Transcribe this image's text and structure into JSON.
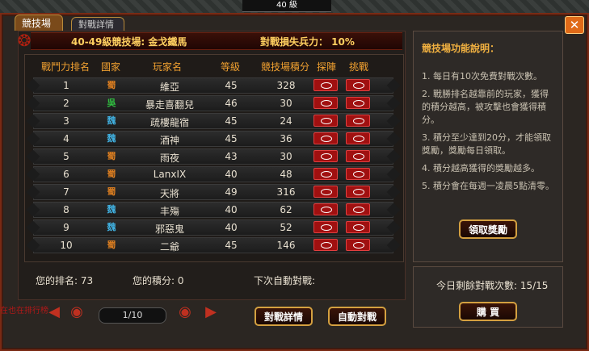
{
  "tabs": [
    {
      "label": "競技場"
    },
    {
      "label": "對戰詳情"
    }
  ],
  "top_strip": "40 級",
  "title": {
    "arena": "40-49級競技場: 金戈鐵馬",
    "loss": "對戰損失兵力： 10%"
  },
  "table": {
    "headers": [
      "戰鬥力排名",
      "國家",
      "玩家名",
      "等級",
      "競技場積分",
      "探陣",
      "挑戰"
    ],
    "rows": [
      {
        "rank": "1",
        "country": "蜀",
        "name": "維亞",
        "level": "45",
        "score": "328"
      },
      {
        "rank": "2",
        "country": "吳",
        "name": "暴走喜翻兒",
        "level": "46",
        "score": "30"
      },
      {
        "rank": "3",
        "country": "魏",
        "name": "疏樓龍宿",
        "level": "45",
        "score": "24"
      },
      {
        "rank": "4",
        "country": "魏",
        "name": "酒神",
        "level": "45",
        "score": "36"
      },
      {
        "rank": "5",
        "country": "蜀",
        "name": "雨夜",
        "level": "43",
        "score": "30"
      },
      {
        "rank": "6",
        "country": "蜀",
        "name": "LanxIX",
        "level": "40",
        "score": "48"
      },
      {
        "rank": "7",
        "country": "蜀",
        "name": "天將",
        "level": "49",
        "score": "316"
      },
      {
        "rank": "8",
        "country": "魏",
        "name": "丰殤",
        "level": "40",
        "score": "62"
      },
      {
        "rank": "9",
        "country": "魏",
        "name": "邪惡鬼",
        "level": "40",
        "score": "52"
      },
      {
        "rank": "10",
        "country": "蜀",
        "name": "二爺",
        "level": "45",
        "score": "146"
      }
    ]
  },
  "info": {
    "your_rank": "您的排名: 73",
    "your_score": "您的積分: 0",
    "next_auto": "下次自動對戰:"
  },
  "pager": {
    "label": "1/10"
  },
  "buttons": {
    "battle_detail": "對戰詳情",
    "auto_battle": "自動對戰",
    "claim_reward": "領取獎勵",
    "buy": "購 買"
  },
  "help": {
    "title": "競技場功能說明：",
    "items": [
      "1. 每日有10次免費對戰次數。",
      "2. 戰勝排名越靠前的玩家，獲得的積分越高，被攻擊也會獲得積分。",
      "3. 積分至少達到20分，才能領取獎勵，獎勵每日領取。",
      "4. 積分越高獲得的獎勵越多。",
      "5. 積分會在每週一凌晨5點清零。"
    ]
  },
  "remaining": "今日剩餘對戰次數: 15/15",
  "bottom_left_text": "在也在排行榜",
  "colors": {
    "蜀": "#e08020",
    "吳": "#30c040",
    "魏": "#40b0e0",
    "accent_gold": "#ffd060",
    "header_orange": "#f0a030",
    "button_red": "#a01010"
  },
  "icons": {
    "close": "close-icon",
    "scout": "eye-icon",
    "challenge": "sword-icon",
    "prev": "arrow-left-icon",
    "next": "arrow-right-icon"
  }
}
